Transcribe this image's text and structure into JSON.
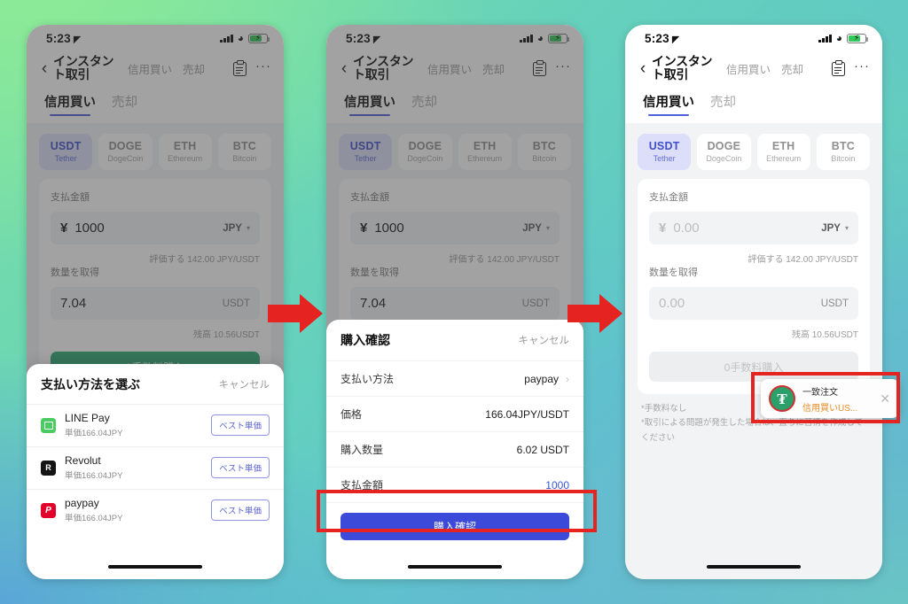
{
  "meta": {
    "colors": {
      "accent_blue": "#3b4ad9",
      "accent_green": "#2eab75",
      "highlight_red": "#e52421",
      "toast_orange": "#e8891e",
      "selected_chip_bg": "#dcdefa"
    }
  },
  "statusbar": {
    "time": "5:23",
    "location_glyph": "◤",
    "signal": "signal-bars-icon",
    "wifi": "wifi-icon",
    "battery": "battery-charging-icon"
  },
  "navbar": {
    "back": "‹",
    "title": "インスタント取引",
    "links": [
      "信用買い",
      "売却"
    ],
    "clipboard_icon": "clipboard-icon",
    "more": "···"
  },
  "tabs": [
    {
      "label": "信用買い",
      "active": true
    },
    {
      "label": "売却",
      "active": false
    }
  ],
  "coins": [
    {
      "symbol": "USDT",
      "name": "Tether",
      "active": true
    },
    {
      "symbol": "DOGE",
      "name": "DogeCoin",
      "active": false
    },
    {
      "symbol": "ETH",
      "name": "Ethereum",
      "active": false
    },
    {
      "symbol": "BTC",
      "name": "Bitcoin",
      "active": false
    }
  ],
  "form": {
    "pay_label": "支払金額",
    "currency_symbol": "¥",
    "currency_unit": "JPY",
    "rate_hint": "評価する 142.00 JPY/USDT",
    "get_label": "数量を取得",
    "coin_unit": "USDT",
    "balance_hint": "残高 10.56USDT",
    "cta_label": "0手数料購入",
    "filled": {
      "pay_value": "1000",
      "get_value": "7.04"
    },
    "empty": {
      "pay_value": "0.00",
      "get_value": "0.00"
    }
  },
  "footnotes": [
    "*手数料なし",
    "*取引による問題が発生した場合は、直ちに苦情を作成してください"
  ],
  "payment_sheet": {
    "title": "支払い方法を選ぶ",
    "cancel": "キャンセル",
    "methods": [
      {
        "name": "LINE Pay",
        "sub": "単価166.04JPY",
        "badge": "ベスト単価",
        "icon": "line-pay-icon"
      },
      {
        "name": "Revolut",
        "sub": "単価166.04JPY",
        "badge": "ベスト単価",
        "icon": "revolut-icon"
      },
      {
        "name": "paypay",
        "sub": "単価166.04JPY",
        "badge": "ベスト単価",
        "icon": "paypay-icon"
      }
    ]
  },
  "confirm_modal": {
    "title": "購入確認",
    "cancel": "キャンセル",
    "rows": [
      {
        "key": "支払い方法",
        "value": "paypay",
        "chevron": "›"
      },
      {
        "key": "価格",
        "value": "166.04JPY/USDT",
        "chevron": ""
      },
      {
        "key": "購入数量",
        "value": "6.02 USDT",
        "chevron": ""
      },
      {
        "key": "支払金額",
        "value": "1000",
        "chevron": "",
        "highlight": true
      }
    ],
    "button_label": "購入確認"
  },
  "toast": {
    "icon": "tether-coin-icon",
    "title": "一致注文",
    "subtitle": "信用買いUS...",
    "close": "✕"
  }
}
